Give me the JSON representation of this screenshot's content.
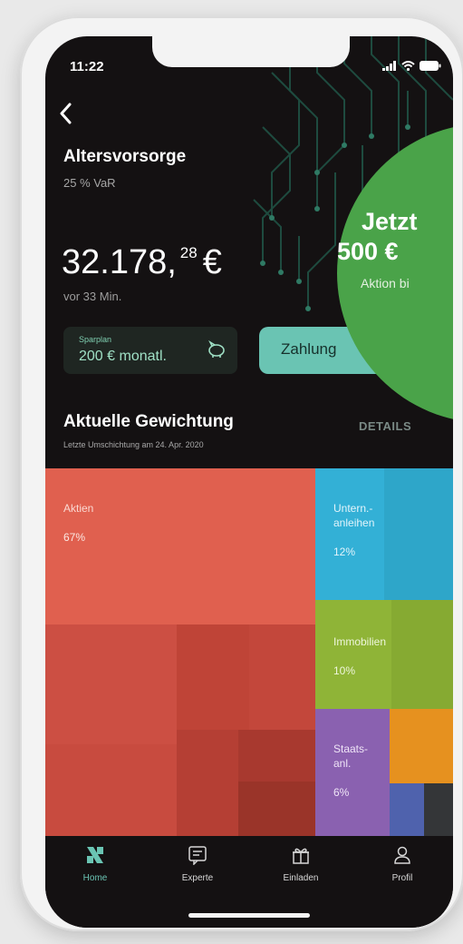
{
  "status": {
    "time": "11:22"
  },
  "header": {
    "title": "Altersvorsorge",
    "subtitle": "25 % VaR"
  },
  "balance": {
    "main": "32.178,",
    "cents": "28",
    "currency": "€",
    "updated": "vor 33 Min."
  },
  "sparplan": {
    "label": "Sparplan",
    "value": "200 € monatl."
  },
  "payment_button": {
    "label": "Zahlung"
  },
  "promo": {
    "line1": "Jetzt",
    "line2": "500 €",
    "line3": "Aktion bi",
    "color": "#4aa349"
  },
  "allocation": {
    "title": "Aktuelle Gewichtung",
    "subtitle": "Letzte Umschichtung am 24. Apr. 2020",
    "details_label": "DETAILS",
    "tiles": [
      {
        "label": "Aktien",
        "percent": "67%",
        "value": 67,
        "color": "#e0604f"
      },
      {
        "label": "Untern.-\nanleihen",
        "percent": "12%",
        "value": 12,
        "color": "#33b0d6"
      },
      {
        "label": "Immobilien",
        "percent": "10%",
        "value": 10,
        "color": "#8fb437"
      },
      {
        "label": "Staats-\nanl.",
        "percent": "6%",
        "value": 6,
        "color": "#8a61b0"
      }
    ]
  },
  "tabs": [
    {
      "label": "Home",
      "icon": "logo-icon",
      "active": true
    },
    {
      "label": "Experte",
      "icon": "chat-icon",
      "active": false
    },
    {
      "label": "Einladen",
      "icon": "gift-icon",
      "active": false
    },
    {
      "label": "Profil",
      "icon": "person-icon",
      "active": false
    }
  ]
}
